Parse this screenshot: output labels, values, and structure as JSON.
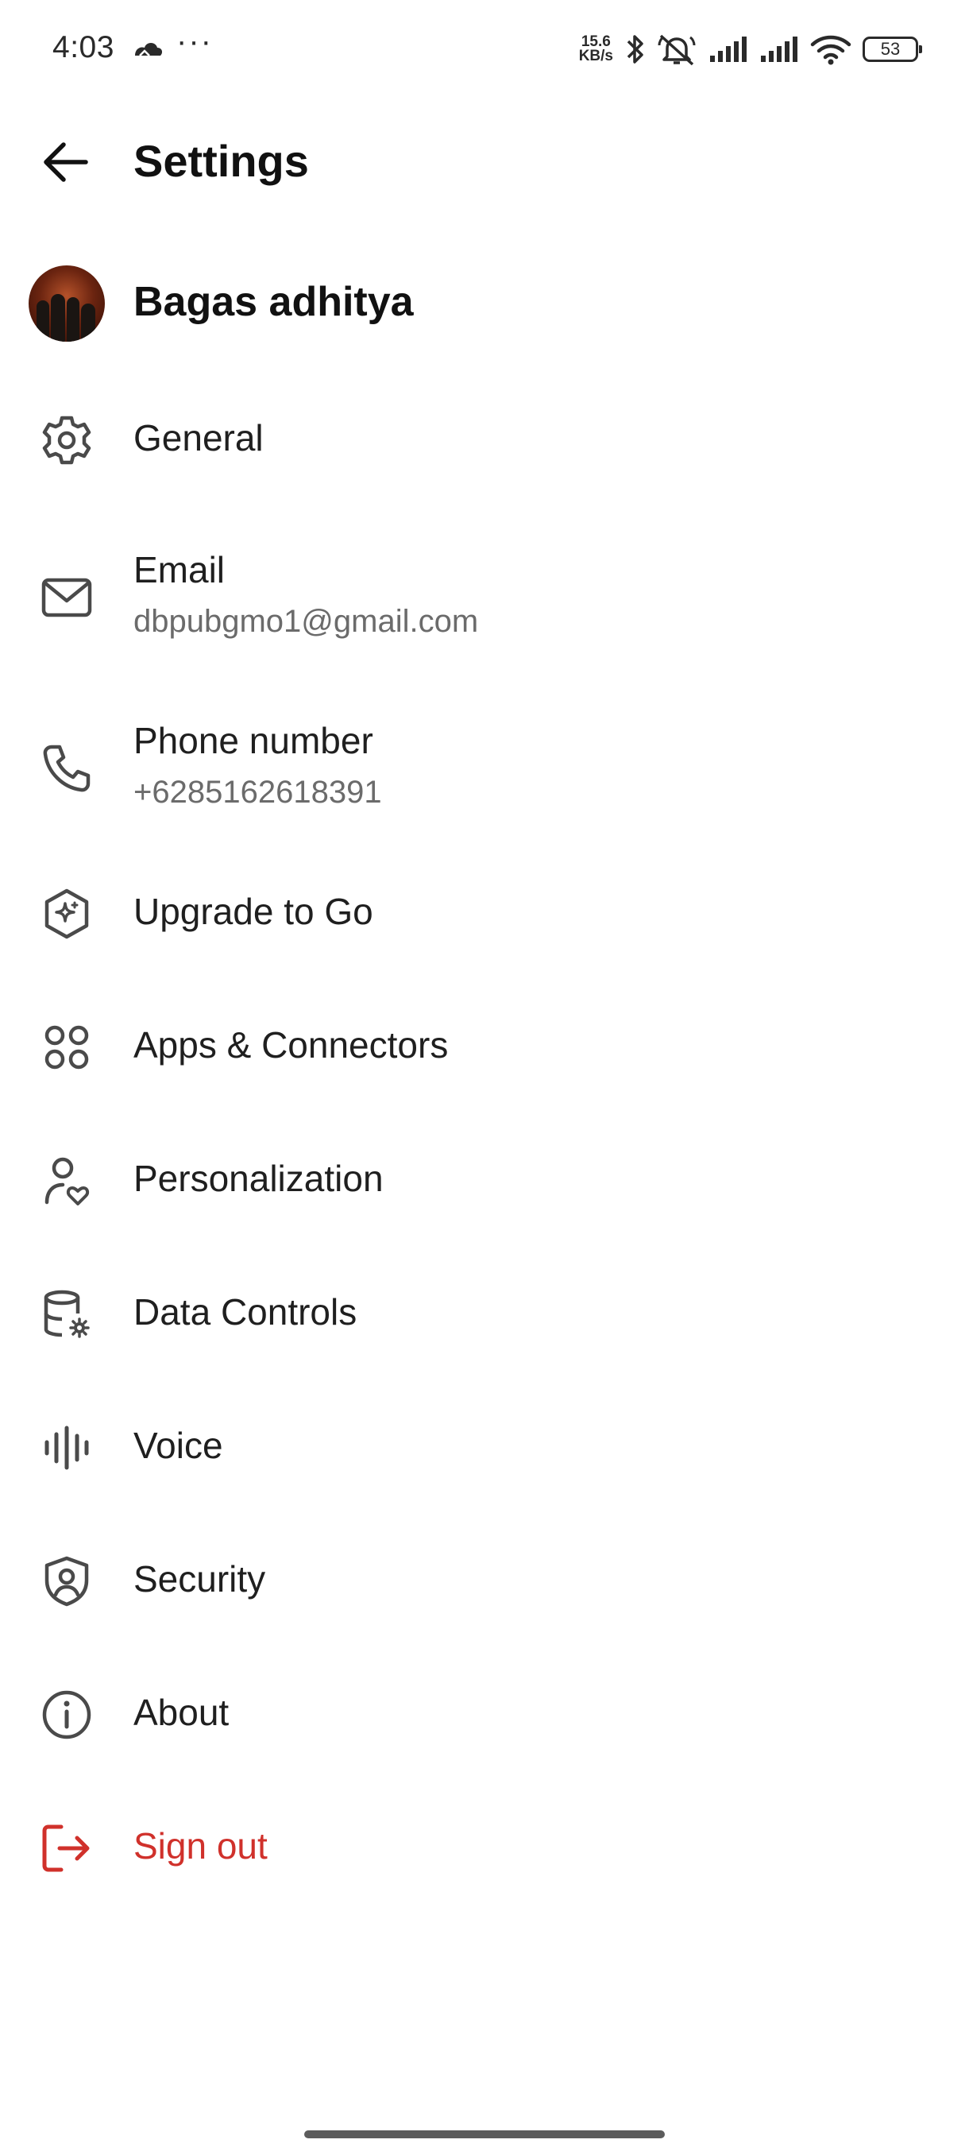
{
  "status_bar": {
    "time": "4:03",
    "more": "···",
    "speed_value": "15.6",
    "speed_unit": "KB/s",
    "battery": "53",
    "icons": [
      "notification-cloud-icon",
      "bluetooth-icon",
      "mute-icon",
      "signal-icon",
      "signal-icon",
      "wifi-icon",
      "battery-icon"
    ]
  },
  "header": {
    "title": "Settings",
    "back_icon": "arrow-left-icon"
  },
  "profile": {
    "name": "Bagas adhitya"
  },
  "menu": [
    {
      "label": "General",
      "icon": "gear-icon"
    },
    {
      "label": "Email",
      "sub": "dbpubgmo1@gmail.com",
      "icon": "mail-icon"
    },
    {
      "label": "Phone number",
      "sub": "+6285162618391",
      "icon": "phone-icon"
    },
    {
      "label": "Upgrade to Go",
      "icon": "sparkle-hexagon-icon"
    },
    {
      "label": "Apps & Connectors",
      "icon": "apps-grid-icon"
    },
    {
      "label": "Personalization",
      "icon": "person-heart-icon"
    },
    {
      "label": "Data Controls",
      "icon": "database-gear-icon"
    },
    {
      "label": "Voice",
      "icon": "waveform-icon"
    },
    {
      "label": "Security",
      "icon": "shield-user-icon"
    },
    {
      "label": "About",
      "icon": "info-icon"
    },
    {
      "label": "Sign out",
      "icon": "sign-out-icon"
    }
  ],
  "colors": {
    "danger": "#d0312b",
    "text": "#1f1f1f",
    "secondary_text": "#6b6b6b"
  }
}
